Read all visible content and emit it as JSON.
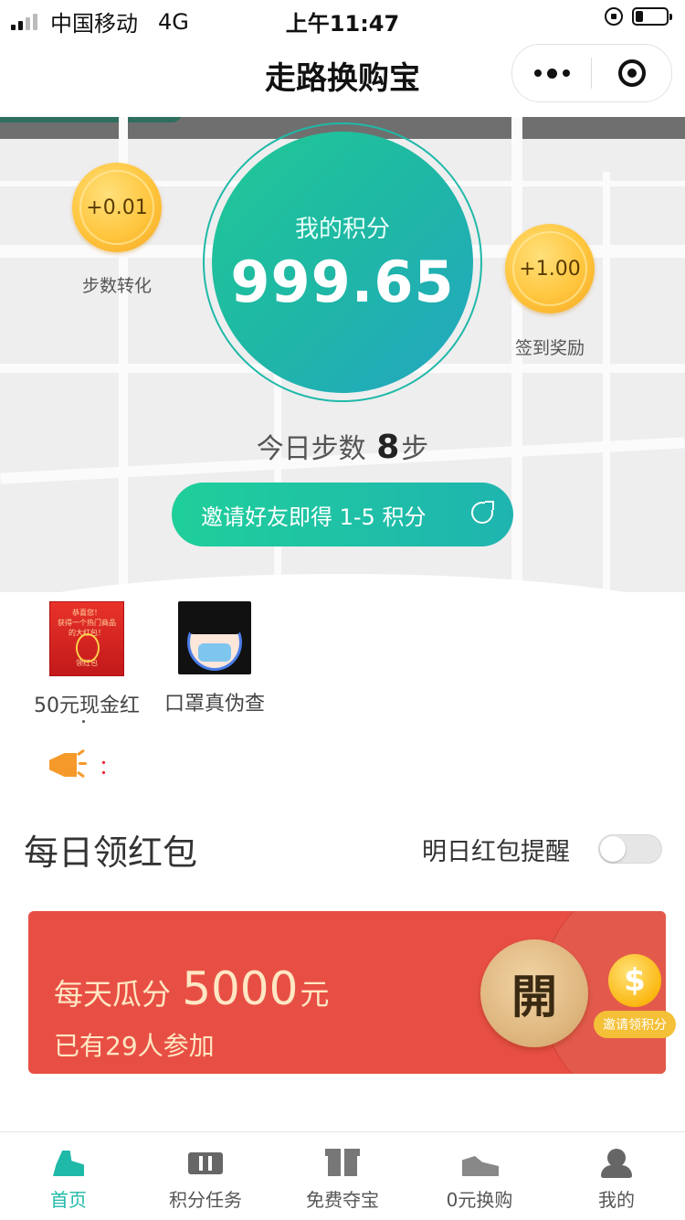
{
  "status_bar": {
    "carrier": "中国移动",
    "network": "4G",
    "time": "上午11:47"
  },
  "navbar": {
    "title": "走路换购宝"
  },
  "coins": {
    "left": {
      "value": "+0.01",
      "label": "步数转化"
    },
    "right": {
      "value": "+1.00",
      "label": "签到奖励"
    }
  },
  "points": {
    "label": "我的积分",
    "value": "999.65"
  },
  "steps": {
    "prefix": "今日步数",
    "count": "8",
    "unit": "步"
  },
  "invite": {
    "label": "邀请好友即得 1-5 积分"
  },
  "shortcuts": [
    {
      "label": "50元现金红",
      "image_text": "恭喜您！获得一个热门商品的大红包！\n领红包"
    },
    {
      "label": "口罩真伪查"
    }
  ],
  "announcement": {
    "text": "："
  },
  "daily": {
    "title": "每日领红包",
    "remind_label": "明日红包提醒",
    "remind_on": false
  },
  "banner": {
    "line1_prefix": "每天瓜分",
    "line1_amount": "5000",
    "line1_unit": "元",
    "line2": "已有29人参加",
    "open_label": "開",
    "invite_tag": "邀请领积分",
    "coin_symbol": "$"
  },
  "tabbar": [
    {
      "label": "首页",
      "icon": "shoe-icon",
      "active": true
    },
    {
      "label": "积分任务",
      "icon": "ticket-icon",
      "active": false
    },
    {
      "label": "免费夺宝",
      "icon": "gift-icon",
      "active": false
    },
    {
      "label": "0元换购",
      "icon": "sneaker-icon",
      "active": false
    },
    {
      "label": "我的",
      "icon": "user-icon",
      "active": false
    }
  ],
  "colors": {
    "accent": "#1fb9a8",
    "banner_red": "#e84f44",
    "coin_gold": "#ffc53d"
  }
}
